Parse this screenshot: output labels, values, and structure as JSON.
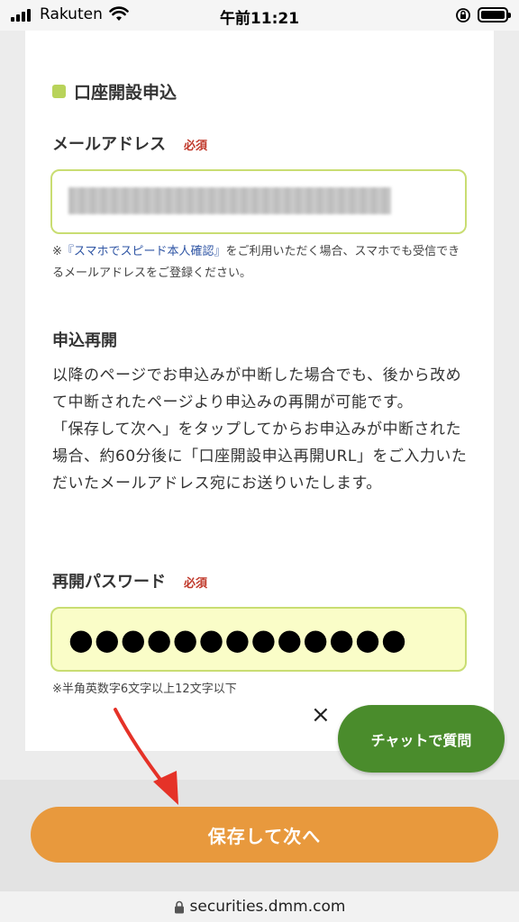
{
  "status": {
    "carrier": "Rakuten",
    "time": "午前11:21"
  },
  "section": {
    "title": "口座開設申込"
  },
  "email": {
    "label": "メールアドレス",
    "required": "必須",
    "note_prefix": "※",
    "note_link": "『スマホでスピード本人確認』",
    "note_suffix": "をご利用いただく場合、スマホでも受信できるメールアドレスをご登録ください。"
  },
  "resume": {
    "title": "申込再開",
    "para1": "以降のページでお申込みが中断した場合でも、後から改めて中断されたページより申込みの再開が可能です。",
    "para2": "「保存して次へ」をタップしてからお申込みが中断された場合、約60分後に「口座開設申込再開URL」をご入力いただいたメールアドレス宛にお送りいたします。"
  },
  "password": {
    "label": "再開パスワード",
    "required": "必須",
    "value": "●●●●●●●●●●●●●",
    "note": "※半角英数字6文字以上12文字以下"
  },
  "chat": {
    "close": "×",
    "label": "チャットで質問"
  },
  "save_button": {
    "label": "保存して次へ"
  },
  "url": {
    "domain": "securities.dmm.com"
  },
  "colors": {
    "accent_green": "#b8d35a",
    "save_orange": "#e8993d",
    "chat_green": "#4a8c2c",
    "required_red": "#c0392b",
    "annotation_arrow": "#e53228"
  }
}
